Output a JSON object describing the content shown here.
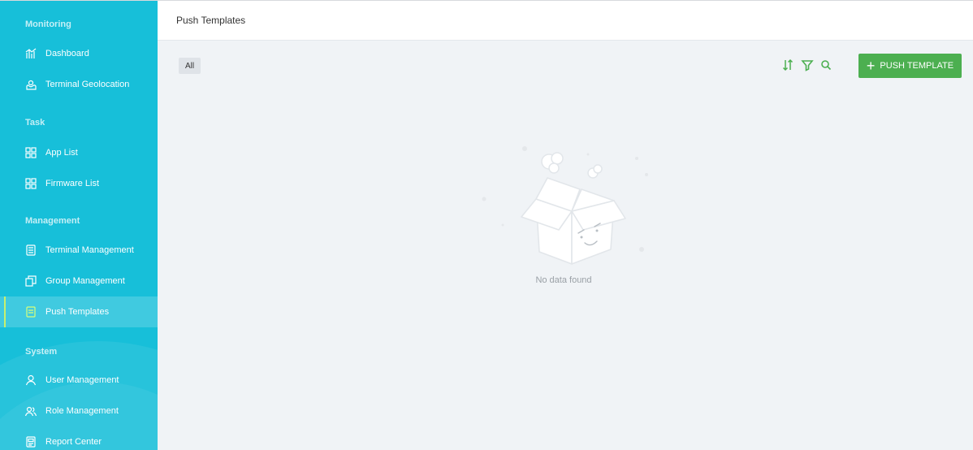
{
  "sidebar": {
    "sections": {
      "monitoring": "Monitoring",
      "task": "Task",
      "management": "Management",
      "system": "System"
    },
    "items": [
      {
        "label": "Dashboard",
        "icon": "dashboard-icon"
      },
      {
        "label": "Terminal Geolocation",
        "icon": "geolocation-icon"
      },
      {
        "label": "App List",
        "icon": "grid-icon"
      },
      {
        "label": "Firmware List",
        "icon": "grid-icon"
      },
      {
        "label": "Terminal Management",
        "icon": "terminal-icon"
      },
      {
        "label": "Group Management",
        "icon": "group-icon"
      },
      {
        "label": "Push Templates",
        "icon": "template-icon",
        "active": true
      },
      {
        "label": "User Management",
        "icon": "user-icon"
      },
      {
        "label": "Role Management",
        "icon": "role-icon"
      },
      {
        "label": "Report Center",
        "icon": "report-icon"
      }
    ],
    "colors": {
      "background": "#17bfd9",
      "active_marker": "#c7f06d"
    }
  },
  "header": {
    "title": "Push Templates"
  },
  "toolbar": {
    "filter_chip": "All",
    "icons": [
      "sort-icon",
      "filter-icon",
      "search-icon"
    ],
    "push_button": {
      "label": "PUSH TEMPLATE",
      "icon": "plus-icon",
      "color": "#4caf50"
    },
    "accent": "#4caf50"
  },
  "empty_state": {
    "message": "No data found",
    "icon": "empty-box-icon"
  }
}
